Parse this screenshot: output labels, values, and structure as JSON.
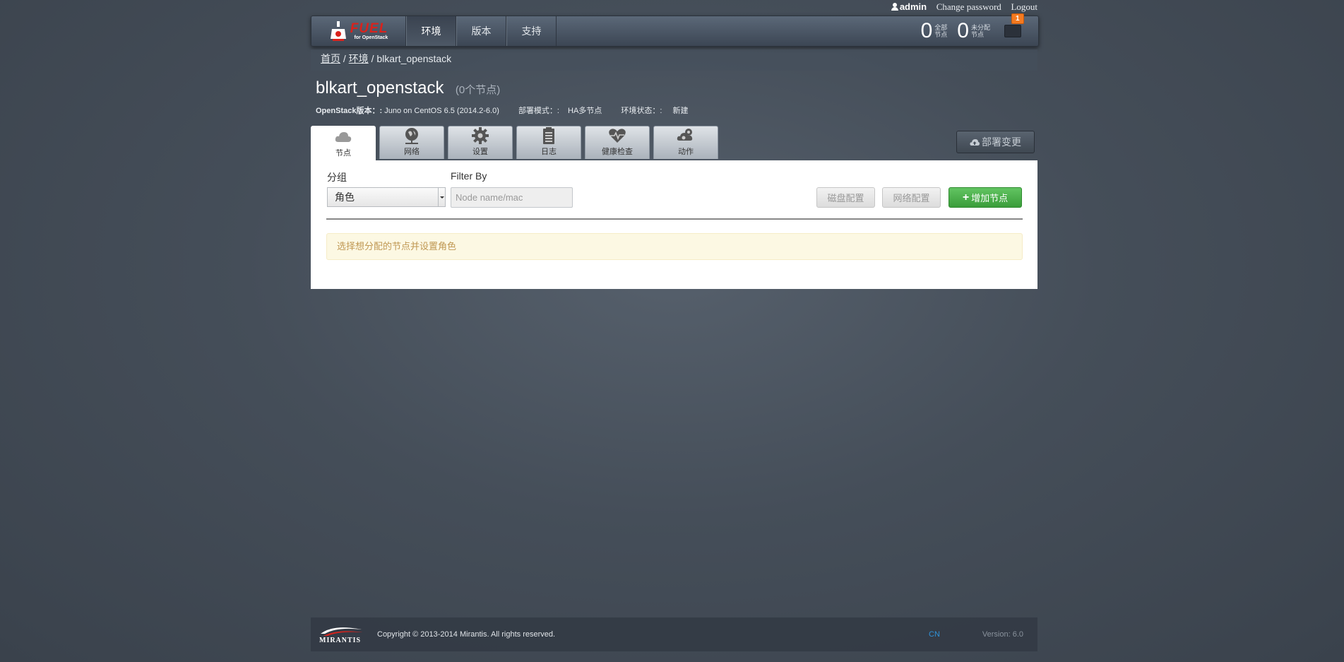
{
  "user": {
    "name": "admin",
    "change_password": "Change password",
    "logout": "Logout"
  },
  "nav": {
    "logo_title": "FUEL",
    "logo_sub": "for OpenStack",
    "items": [
      {
        "label": "环境",
        "active": true
      },
      {
        "label": "版本",
        "active": false
      },
      {
        "label": "支持",
        "active": false
      }
    ],
    "stats": [
      {
        "value": "0",
        "label_line1": "全部",
        "label_line2": "节点"
      },
      {
        "value": "0",
        "label_line1": "未分配",
        "label_line2": "节点"
      }
    ],
    "notifications_count": "1"
  },
  "breadcrumb": {
    "home": "首页",
    "sep": "/",
    "environments": "环境",
    "current": "blkart_openstack"
  },
  "cluster": {
    "name": "blkart_openstack",
    "nodes_count": "(0个节点)",
    "openstack_label": "OpenStack版本：:",
    "openstack_value": "Juno on CentOS 6.5 (2014.2-6.0)",
    "mode_label": "部署模式：:",
    "mode_value": "HA多节点",
    "status_label": "环境状态：:",
    "status_value": "新建"
  },
  "tabs": [
    {
      "label": "节点",
      "icon": "cloud-icon",
      "active": true
    },
    {
      "label": "网络",
      "icon": "network-icon",
      "active": false
    },
    {
      "label": "设置",
      "icon": "gear-icon",
      "active": false
    },
    {
      "label": "日志",
      "icon": "clipboard-icon",
      "active": false
    },
    {
      "label": "健康检查",
      "icon": "heart-icon",
      "active": false
    },
    {
      "label": "动作",
      "icon": "gears-icon",
      "active": false
    }
  ],
  "deploy_button": "部署变更",
  "nodes_panel": {
    "group_label": "分组",
    "group_value": "角色",
    "filter_label": "Filter By",
    "filter_placeholder": "Node name/mac",
    "disk_config": "磁盘配置",
    "network_config": "网络配置",
    "add_nodes": "增加节点",
    "notice": "选择想分配的节点并设置角色"
  },
  "footer": {
    "brand": "MIRANTIS",
    "copyright": "Copyright © 2013-2014 Mirantis. All rights reserved.",
    "language": "CN",
    "version": "Version: 6.0"
  },
  "colors": {
    "accent_green": "#3a9d3a",
    "brand_red": "#d9221c",
    "notification_orange": "#f47a20",
    "notice_bg": "#fcf8e3",
    "notice_text": "#c09853"
  }
}
